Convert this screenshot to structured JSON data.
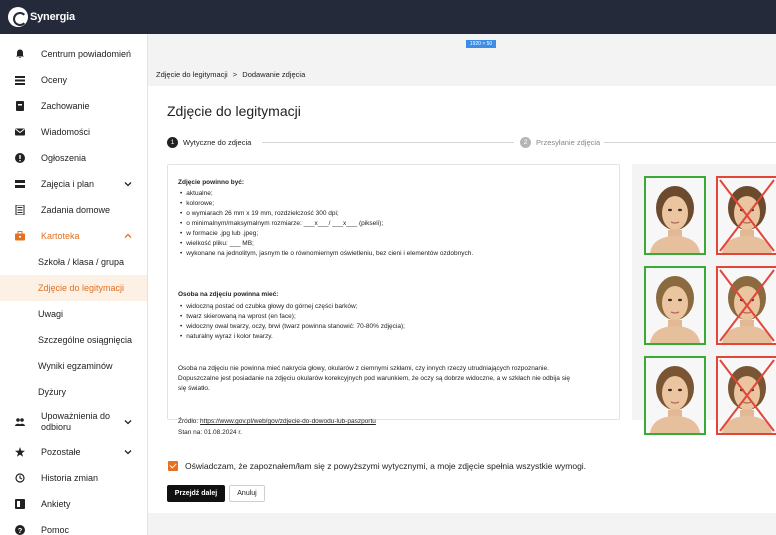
{
  "app": {
    "logo_text": "Synergia"
  },
  "resolution_badge": "1920 × 50",
  "sidebar": {
    "items": [
      {
        "label": "Centrum powiadomień",
        "icon": "bell-icon"
      },
      {
        "label": "Oceny",
        "icon": "list-icon"
      },
      {
        "label": "Zachowanie",
        "icon": "badge-icon"
      },
      {
        "label": "Wiadomości",
        "icon": "mail-icon"
      },
      {
        "label": "Ogłoszenia",
        "icon": "alert-icon"
      },
      {
        "label": "Zajęcia i plan",
        "icon": "schedule-icon"
      },
      {
        "label": "Zadania domowe",
        "icon": "homework-icon"
      },
      {
        "label": "Kartoteka",
        "icon": "briefcase-icon"
      },
      {
        "label": "Szkoła / klasa / grupa"
      },
      {
        "label": "Zdjęcie do legitymacji"
      },
      {
        "label": "Uwagi"
      },
      {
        "label": "Szczególne osiągnięcia"
      },
      {
        "label": "Wyniki egzaminów"
      },
      {
        "label": "Dyżury"
      },
      {
        "label": "Upoważnienia do odbioru",
        "icon": "people-icon"
      },
      {
        "label": "Pozostałe",
        "icon": "star-icon"
      },
      {
        "label": "Historia zmian",
        "icon": "history-icon"
      },
      {
        "label": "Ankiety",
        "icon": "survey-icon"
      },
      {
        "label": "Pomoc",
        "icon": "help-icon"
      }
    ]
  },
  "breadcrumb": {
    "parent": "Zdjęcie do legitymacji",
    "separator": ">",
    "current": "Dodawanie zdjęcia"
  },
  "page_title": "Zdjęcie do legitymacji",
  "steps": [
    {
      "number": "1",
      "label": "Wytyczne do zdjecia"
    },
    {
      "number": "2",
      "label": "Przesyłanie zdjęcia"
    }
  ],
  "guidelines": {
    "section1_heading": "Zdjęcie powinno być:",
    "section1_items": [
      "aktualne;",
      "kolorowe;",
      "o wymiarach 26 mm x 19 mm, rozdzielczość 300 dpi;",
      "o minimalnym/maksymalnym rozmiarze: ___x___/ ___x___ (pikseli);",
      "w formacie .jpg lub .jpeg;",
      "wielkość pliku: ___ MB;",
      "wykonane na jednolitym, jasnym tle o równomiernym oświetleniu, bez cieni i elementów ozdobnych."
    ],
    "section2_heading": "Osoba na zdjęciu powinna mieć:",
    "section2_items": [
      "widoczną postać od czubka głowy do górnej części barków;",
      "twarz skierowaną na wprost (en face);",
      "widoczny owal twarzy, oczy, brwi (twarz powinna stanowić: 70-80% zdjęcia);",
      "naturalny wyraz i kolor twarzy."
    ],
    "note_line1": "Osoba na zdjęciu nie powinna mieć nakrycia głowy, okularów z ciemnymi szkłami, czy innych rzeczy utrudniających rozpoznanie.",
    "note_line2": "Dopuszczalne jest posiadanie na zdjęciu okularów korekcyjnych pod warunkiem, że oczy są dobrze widoczne, a w szkłach nie odbija się",
    "note_line3": "się światło.",
    "source_label": "Źródło:",
    "source_url": "https://www.gov.pl/web/gov/zdjecie-do-dowodu-lub-paszportu",
    "date_label": "Stan na: 01.08.2024 r."
  },
  "consent_text": "Oświadczam, że zapoznałem/łam się z powyższymi wytycznymi, a moje zdjęcie spełnia wszystkie wymogi.",
  "buttons": {
    "next": "Przejdź dalej",
    "cancel": "Anuluj"
  },
  "colors": {
    "accent": "#e47021",
    "topbar": "#252a3a",
    "valid": "#3aa935",
    "invalid": "#e2463b"
  }
}
